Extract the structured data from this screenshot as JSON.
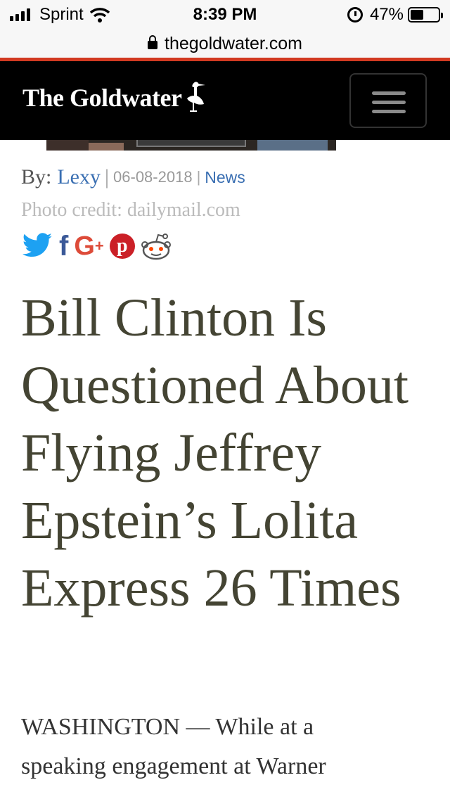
{
  "status_bar": {
    "carrier": "Sprint",
    "time": "8:39 PM",
    "battery_percent": "47%",
    "battery_level": 0.47,
    "icons": [
      "signal-bars-icon",
      "wifi-icon",
      "alarm-icon",
      "battery-icon"
    ]
  },
  "browser": {
    "url": "thegoldwater.com",
    "lock_icon": "lock-icon",
    "accent_color": "#d23a22"
  },
  "site_header": {
    "logo_text": "The Goldwater",
    "logo_icon": "heron-bird-icon",
    "menu_icon": "hamburger-menu-icon",
    "background": "#000000"
  },
  "article": {
    "byline_label": "By:",
    "author": "Lexy",
    "date": "06-08-2018",
    "category": "News",
    "photo_credit": "Photo credit: dailymail.com",
    "share_icons": [
      "twitter-icon",
      "facebook-icon",
      "google-plus-icon",
      "pinterest-icon",
      "reddit-icon"
    ],
    "headline": "Bill Clinton Is Questioned About Flying Jeffrey Epstein’s Lolita Express 26 Times",
    "body_lines": [
      "WASHINGTON — While at a",
      "speaking engagement at Warner"
    ],
    "link_color": "#3a6fb2"
  }
}
